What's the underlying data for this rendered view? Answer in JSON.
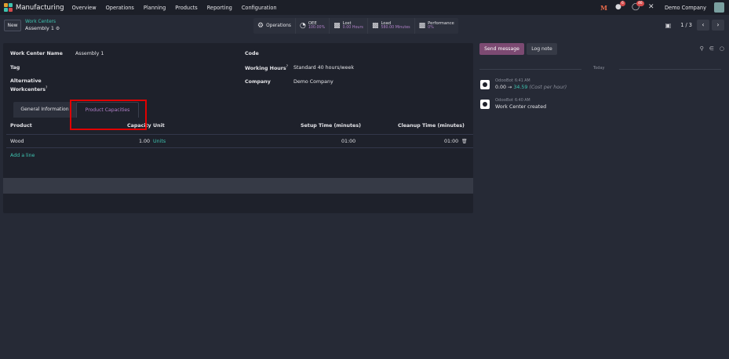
{
  "navbar": {
    "app_title": "Manufacturing",
    "menu": [
      "Overview",
      "Operations",
      "Planning",
      "Products",
      "Reporting",
      "Configuration"
    ],
    "user_initial": "M",
    "chat_badge": "6",
    "activity_badge": "46",
    "company": "Demo Company"
  },
  "control": {
    "new_label": "New",
    "breadcrumb_parent": "Work Centers",
    "breadcrumb_current": "Assembly 1",
    "smart_buttons": {
      "operations": "Operations",
      "oee_title": "OEE",
      "oee_value": "100.00%",
      "lost_title": "Lost",
      "lost_value": "0.00 Hours",
      "load_title": "Load",
      "load_value": "580.00 Minutes",
      "performance_title": "Performance",
      "performance_value": "0%"
    },
    "pager_value": "1 / 3"
  },
  "form": {
    "work_center_name_label": "Work Center Name",
    "work_center_name_value": "Assembly 1",
    "tag_label": "Tag",
    "alternative_label_1": "Alternative",
    "alternative_label_2": "Workcenters",
    "code_label": "Code",
    "working_hours_label": "Working Hours",
    "working_hours_value": "Standard 40 hours/week",
    "company_label": "Company",
    "company_value": "Demo Company",
    "help_mark": "?"
  },
  "tabs": {
    "general": "General Information",
    "capacities": "Product Capacities"
  },
  "table": {
    "headers": {
      "product": "Product",
      "capacity": "Capacity",
      "unit": "Unit",
      "setup": "Setup Time (minutes)",
      "cleanup": "Cleanup Time (minutes)"
    },
    "rows": [
      {
        "product": "Wood",
        "capacity": "1.00",
        "unit": "Units",
        "setup": "01:00",
        "cleanup": "01:00"
      }
    ],
    "add_line": "Add a line"
  },
  "chatter": {
    "send_message": "Send message",
    "log_note": "Log note",
    "date_separator": "Today",
    "messages": [
      {
        "author": "OdooBot",
        "time": "6:41 AM",
        "old_value": "0.00",
        "arrow": "→",
        "new_value": "34.59",
        "field": "(Cost per hour)"
      },
      {
        "author": "OdooBot",
        "time": "6:40 AM",
        "body": "Work Center created"
      }
    ]
  },
  "colors": {
    "accent_teal": "#3ec4b0",
    "accent_purple": "#7c4a72",
    "highlight_red": "#e00000"
  }
}
